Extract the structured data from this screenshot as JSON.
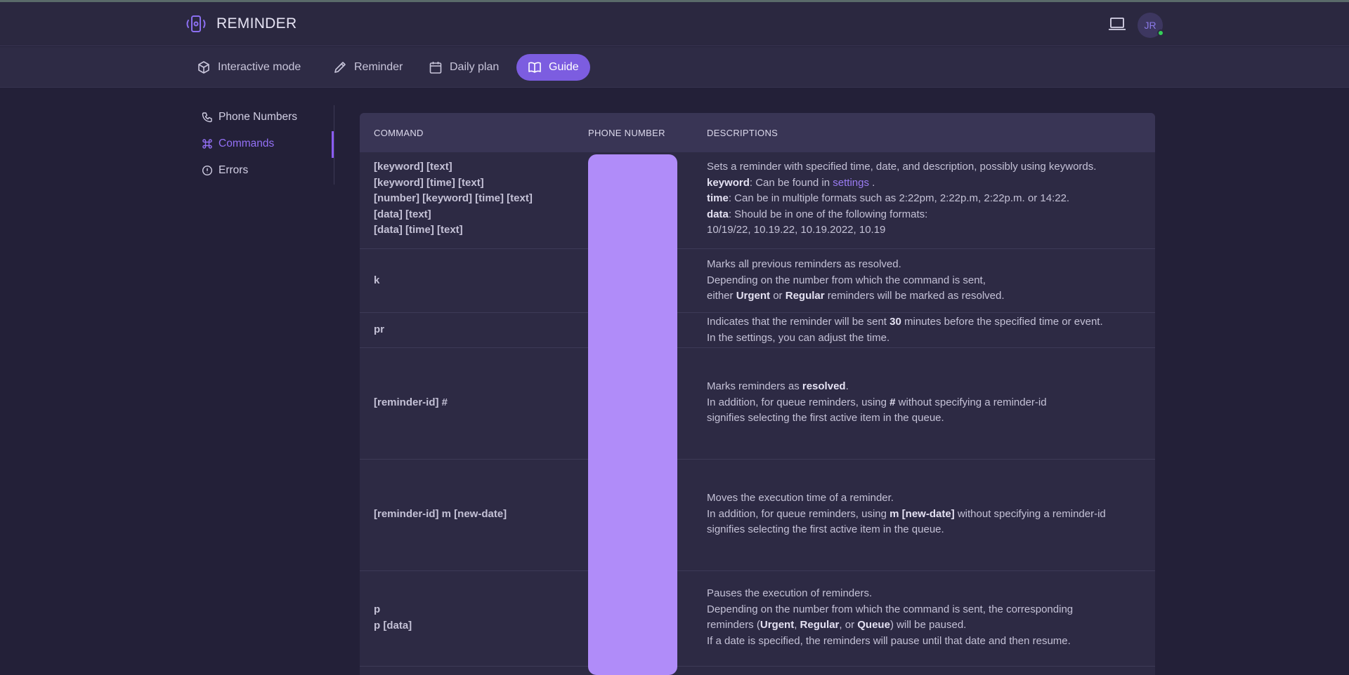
{
  "app": {
    "title": "REMINDER"
  },
  "user": {
    "initials": "JR",
    "status_color": "#34d058"
  },
  "colors": {
    "accent": "#7c5de0",
    "link": "#9b7cf4",
    "background": "#232038"
  },
  "tabs": [
    {
      "label": "Interactive mode",
      "icon": "cube-icon"
    },
    {
      "label": "Reminder",
      "icon": "pencil-icon"
    },
    {
      "label": "Daily plan",
      "icon": "calendar-icon"
    },
    {
      "label": "Guide",
      "icon": "book-icon",
      "active": true
    }
  ],
  "sidebar": {
    "items": [
      {
        "label": "Phone Numbers",
        "icon": "phone-icon"
      },
      {
        "label": "Commands",
        "icon": "command-icon",
        "active": true
      },
      {
        "label": "Errors",
        "icon": "alert-circle-icon"
      }
    ]
  },
  "table": {
    "headers": {
      "command": "COMMAND",
      "phone": "PHONE NUMBER",
      "descriptions": "DESCRIPTIONS"
    },
    "rows": [
      {
        "commands": [
          "[keyword] [text]",
          "[keyword] [time] [text]",
          "[number] [keyword] [time] [text]",
          "[data] [text]",
          "[data] [time] [text]"
        ],
        "desc": {
          "l1": "Sets a reminder with specified time, date, and description, possibly using keywords.",
          "l2_bold": "keyword",
          "l2_text": ": Can be found in ",
          "l2_link": "settings",
          "l2_end": " .",
          "l3_bold": "time",
          "l3_text": ": Can be in multiple formats such as 2:22pm, 2:22p.m, 2:22p.m. or 14:22.",
          "l4_bold": "data",
          "l4_text": ": Should be in one of the following formats:",
          "l5": "10/19/22, 10.19.22, 10.19.2022, 10.19"
        }
      },
      {
        "commands": [
          "k"
        ],
        "desc": {
          "l1": "Marks all previous reminders as resolved.",
          "l2": "Depending on the number from which the command is sent,",
          "l3_a": "either ",
          "l3_b1": "Urgent",
          "l3_c": " or ",
          "l3_b2": "Regular",
          "l3_d": " reminders will be marked as resolved."
        }
      },
      {
        "commands": [
          "pr"
        ],
        "desc": {
          "l1_a": "Indicates that the reminder will be sent ",
          "l1_b": "30",
          "l1_c": " minutes before the specified time or event.",
          "l2": "In the settings, you can adjust the time."
        }
      },
      {
        "commands": [
          "[reminder-id] #"
        ],
        "desc": {
          "l1_a": "Marks reminders as ",
          "l1_b": "resolved",
          "l1_c": ".",
          "l2_a": "In addition, for queue reminders, using ",
          "l2_b": "#",
          "l2_c": " without specifying a reminder-id",
          "l3": "signifies selecting the first active item in the queue."
        }
      },
      {
        "commands": [
          "[reminder-id] m [new-date]"
        ],
        "desc": {
          "l1": "Moves the execution time of a reminder.",
          "l2_a": "In addition, for queue reminders, using ",
          "l2_b": "m [new-date]",
          "l2_c": " without specifying a reminder-id",
          "l3": "signifies selecting the first active item in the queue."
        }
      },
      {
        "commands": [
          "p",
          "p [data]"
        ],
        "desc": {
          "l1": "Pauses the execution of reminders.",
          "l2": "Depending on the number from which the command is sent, the corresponding",
          "l3_a": "reminders (",
          "l3_b1": "Urgent",
          "l3_c": ", ",
          "l3_b2": "Regular",
          "l3_d": ", or ",
          "l3_b3": "Queue",
          "l3_e": ") will be paused.",
          "l4": "If a date is specified, the reminders will pause until that date and then resume."
        }
      }
    ]
  }
}
